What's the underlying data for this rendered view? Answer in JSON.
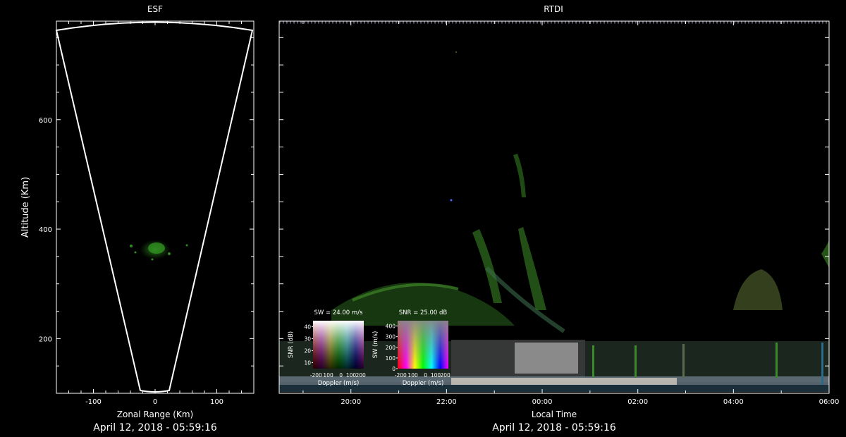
{
  "chart_data": [
    {
      "type": "scatter",
      "title": "ESF",
      "xlabel": "Zonal Range (Km)",
      "ylabel": "Altitude (Km)",
      "xlim": [
        -160,
        160
      ],
      "ylim": [
        100,
        780
      ],
      "xticks": [
        "-100",
        "0",
        "100"
      ],
      "yticks": [
        "200",
        "400",
        "600"
      ],
      "date_label": "April 12, 2018 - 05:59:16",
      "echo": {
        "x": [
          -45,
          40
        ],
        "altitude": [
          330,
          380
        ],
        "color": "#2e8b1f"
      }
    },
    {
      "type": "heatmap",
      "title": "RTDI",
      "xlabel": "Local Time",
      "xticks": [
        "20:00",
        "22:00",
        "00:00",
        "02:00",
        "04:00",
        "06:00"
      ],
      "ylim": [
        100,
        780
      ],
      "date_label": "April 12, 2018 - 05:59:16",
      "legends": [
        {
          "title": "SW = 24.00 m/s",
          "xlabel": "Doppler (m/s)",
          "ylabel": "SNR (dB)",
          "xticks": [
            "-200",
            "100",
            "0",
            "100",
            "200"
          ],
          "yticks": [
            "10",
            "20",
            "30",
            "40"
          ]
        },
        {
          "title": "SNR = 25.00 dB",
          "xlabel": "Doppler (m/s)",
          "ylabel": "SW (m/s)",
          "xticks": [
            "-200",
            "100",
            "0",
            "100",
            "200"
          ],
          "yticks": [
            "0",
            "100",
            "200",
            "300",
            "400"
          ]
        }
      ]
    }
  ]
}
